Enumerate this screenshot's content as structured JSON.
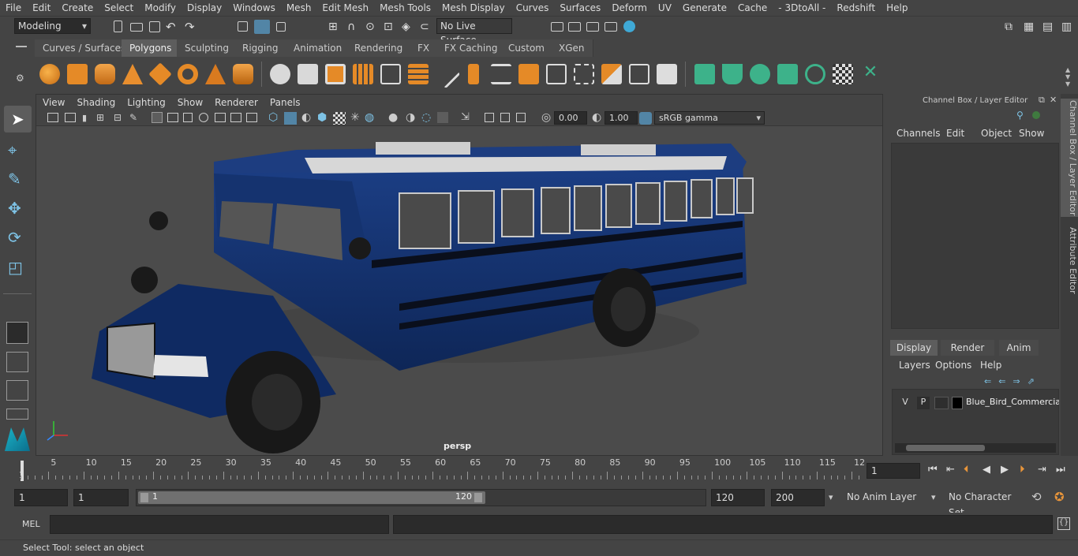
{
  "menubar": {
    "items": [
      "File",
      "Edit",
      "Create",
      "Select",
      "Modify",
      "Display",
      "Windows",
      "Mesh",
      "Edit Mesh",
      "Mesh Tools",
      "Mesh Display",
      "Curves",
      "Surfaces",
      "Deform",
      "UV",
      "Generate",
      "Cache",
      "- 3DtoAll -",
      "Redshift",
      "Help"
    ]
  },
  "statusline": {
    "mode": "Modeling",
    "live_surface": "No Live Surface"
  },
  "shelf": {
    "tabs": [
      "Curves / Surfaces",
      "Polygons",
      "Sculpting",
      "Rigging",
      "Animation",
      "Rendering",
      "FX",
      "FX Caching",
      "Custom",
      "XGen"
    ],
    "active_tab": "Polygons"
  },
  "viewport": {
    "menus": [
      "View",
      "Shading",
      "Lighting",
      "Show",
      "Renderer",
      "Panels"
    ],
    "exposure": "0.00",
    "gamma": "1.00",
    "color_space": "sRGB gamma",
    "camera": "persp",
    "colors": {
      "bus_body": "#13306e",
      "bus_roof": "#c9c9c9",
      "tire": "#181818",
      "background": "#4b4b4b"
    }
  },
  "channel_box": {
    "title": "Channel Box / Layer Editor",
    "menus": [
      "Channels",
      "Edit",
      "Object",
      "Show"
    ],
    "layer_tabs": [
      "Display",
      "Render",
      "Anim"
    ],
    "active_layer_tab": "Display",
    "layer_menus": [
      "Layers",
      "Options",
      "Help"
    ],
    "layer": {
      "v": "V",
      "p": "P",
      "name": "Blue_Bird_Commercial_"
    }
  },
  "side_tabs": [
    "Channel Box / Layer Editor",
    "Attribute Editor"
  ],
  "timeline": {
    "ticks": [
      "5",
      "10",
      "15",
      "20",
      "25",
      "30",
      "35",
      "40",
      "45",
      "50",
      "55",
      "60",
      "65",
      "70",
      "75",
      "80",
      "85",
      "90",
      "95",
      "100",
      "105",
      "110",
      "115",
      "12"
    ],
    "current_frame_marker": "1",
    "current_frame": "1"
  },
  "range": {
    "start": "1",
    "playback_start": "1",
    "slider_start": "1",
    "slider_end": "120",
    "playback_end": "120",
    "end": "200",
    "anim_layer": "No Anim Layer",
    "character_set": "No Character Set"
  },
  "cmdline": {
    "label": "MEL"
  },
  "helpline": {
    "text": "Select Tool: select an object"
  }
}
